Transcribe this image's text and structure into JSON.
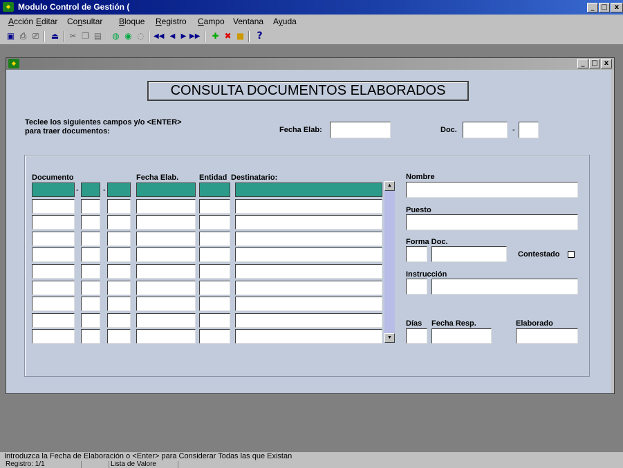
{
  "app": {
    "title": "Modulo Control de Gestión (",
    "icon": "form-app-icon",
    "window_controls": [
      "_",
      "□",
      "x"
    ]
  },
  "menu": [
    {
      "label_pre": "",
      "label_u": "A",
      "label_post": "cción"
    },
    {
      "label_pre": "",
      "label_u": "E",
      "label_post": "ditar"
    },
    {
      "label_pre": "Co",
      "label_u": "n",
      "label_post": "sultar"
    },
    {
      "label_pre": "",
      "label_u": "B",
      "label_post": "loque"
    },
    {
      "label_pre": "",
      "label_u": "R",
      "label_post": "egistro"
    },
    {
      "label_pre": "",
      "label_u": "C",
      "label_post": "ampo"
    },
    {
      "label_pre": "Ventana",
      "label_u": "",
      "label_post": ""
    },
    {
      "label_pre": "A",
      "label_u": "y",
      "label_post": "uda"
    }
  ],
  "toolbar": {
    "icons": [
      "save-icon",
      "print-icon",
      "print-setup-icon",
      "exit-icon",
      "cut-icon",
      "copy-icon",
      "paste-icon",
      "enter-query-icon",
      "execute-query-icon",
      "cancel-query-icon",
      "first-record-icon",
      "previous-record-icon",
      "next-record-icon",
      "last-record-icon",
      "insert-record-icon",
      "delete-record-icon",
      "lock-record-icon",
      "help-icon"
    ],
    "help_glyph": "?"
  },
  "mdi": {
    "controls": [
      "_",
      "□",
      "x"
    ]
  },
  "form": {
    "title": "CONSULTA DOCUMENTOS ELABORADOS",
    "instructions_line1": "Teclee los siguientes campos y/o <ENTER>",
    "instructions_line2": "para traer documentos:",
    "fecha_elab_label": "Fecha Elab:",
    "fecha_elab_value": "",
    "doc_label": "Doc.",
    "doc_value": "",
    "doc_separator": "-",
    "doc_suffix_value": ""
  },
  "table": {
    "headers": {
      "documento": "Documento",
      "fecha_elab": "Fecha Elab.",
      "entidad": "Entidad",
      "destinatario": "Destinatario:"
    },
    "separator": "-",
    "row_count": 10
  },
  "details": {
    "nombre_label": "Nombre",
    "nombre_value": "",
    "puesto_label": "Puesto",
    "puesto_value": "",
    "forma_doc_label": "Forma Doc.",
    "contestado_label": "Contestado",
    "contestado_checked": false,
    "instruccion_label": "Instrucción",
    "dias_label": "Días",
    "fecha_resp_label": "Fecha Resp.",
    "elaborado_label": "Elaborado"
  },
  "status": {
    "message": "Introduzca la Fecha de Elaboración o <Enter> para Considerar Todas las que Existan",
    "registro": "Registro: 1/1",
    "lista_valores": "Lista de Valore"
  }
}
